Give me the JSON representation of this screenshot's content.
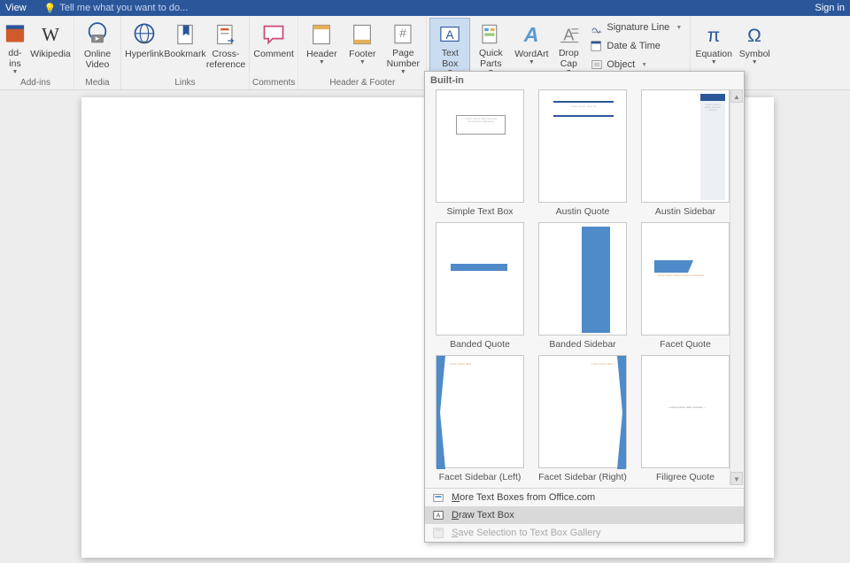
{
  "titlebar": {
    "view": "View",
    "search_placeholder": "Tell me what you want to do...",
    "signin": "Sign in"
  },
  "ribbon": {
    "addins_cut": "dd-ins",
    "wikipedia": "Wikipedia",
    "online_video": "Online\nVideo",
    "hyperlink": "Hyperlink",
    "bookmark": "Bookmark",
    "cross_ref": "Cross-\nreference",
    "comment": "Comment",
    "header": "Header",
    "footer": "Footer",
    "page_number": "Page\nNumber",
    "text_box": "Text\nBox",
    "quick_parts": "Quick\nParts",
    "wordart": "WordArt",
    "drop_cap": "Drop\nCap",
    "sig_line": "Signature Line",
    "date_time": "Date & Time",
    "object": "Object",
    "equation": "Equation",
    "symbol": "Symbol",
    "groups": {
      "addins": "Add-ins",
      "media": "Media",
      "links": "Links",
      "comments": "Comments",
      "header_footer": "Header & Footer"
    }
  },
  "dropdown": {
    "header": "Built-in",
    "items": [
      "Simple Text Box",
      "Austin Quote",
      "Austin Sidebar",
      "Banded Quote",
      "Banded Sidebar",
      "Facet Quote",
      "Facet Sidebar (Left)",
      "Facet Sidebar (Right)",
      "Filigree Quote"
    ],
    "more": "More Text Boxes from Office.com",
    "draw": "Draw Text Box",
    "save": "Save Selection to Text Box Gallery"
  }
}
